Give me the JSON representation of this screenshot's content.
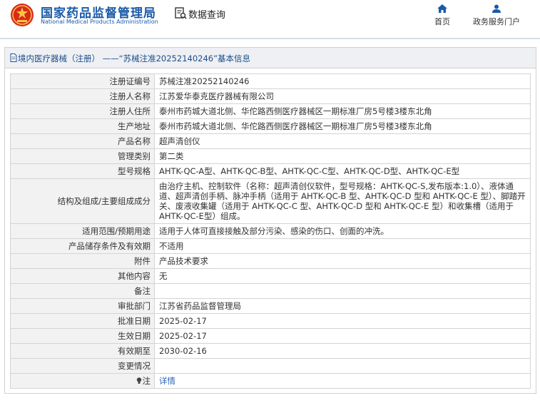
{
  "header": {
    "site_name_cn": "国家药品监督管理局",
    "site_name_en": "National Medical Products Administration",
    "data_query": "数据查询",
    "nav": {
      "home": "首页",
      "service": "政务服务门户"
    }
  },
  "panel": {
    "title": "境内医疗器械（注册） ——“苏械注准20252140246”基本信息"
  },
  "fields": [
    {
      "label": "注册证编号",
      "value": "苏械注准20252140246"
    },
    {
      "label": "注册人名称",
      "value": "江苏爱华泰克医疗器械有限公司"
    },
    {
      "label": "注册人住所",
      "value": "泰州市药城大道北侧、华佗路西侧医疗器械区一期标准厂房5号楼3楼东北角"
    },
    {
      "label": "生产地址",
      "value": "泰州市药城大道北侧、华佗路西侧医疗器械区一期标准厂房5号楼3楼东北角"
    },
    {
      "label": "产品名称",
      "value": "超声清创仪"
    },
    {
      "label": "管理类别",
      "value": "第二类"
    },
    {
      "label": "型号规格",
      "value": "AHTK-QC-A型、AHTK-QC-B型、AHTK-QC-C型、AHTK-QC-D型、AHTK-QC-E型"
    },
    {
      "label": "结构及组成/主要组成成分",
      "value": "由治疗主机、控制软件（名称：超声清创仪软件，型号规格：AHTK-QC-S,发布版本:1.0）、液体通道、超声清创手柄、脉冲手柄（适用于 AHTK-QC-B 型、AHTK-QC-D 型和 AHTK-QC-E 型）、脚踏开关、废液收集罐（适用于 AHTK-QC-C 型、AHTK-QC-D 型和 AHTK-QC-E 型）和收集槽（适用于 AHTK-QC-E型）组成。"
    },
    {
      "label": "适用范围/预期用途",
      "value": "适用于人体可直接接触及部分污染、感染的伤口、创面的冲洗。"
    },
    {
      "label": "产品储存条件及有效期",
      "value": "不适用"
    },
    {
      "label": "附件",
      "value": "产品技术要求"
    },
    {
      "label": "其他内容",
      "value": "无"
    },
    {
      "label": "备注",
      "value": ""
    },
    {
      "label": "审批部门",
      "value": "江苏省药品监督管理局"
    },
    {
      "label": "批准日期",
      "value": "2025-02-17"
    },
    {
      "label": "生效日期",
      "value": "2025-02-17"
    },
    {
      "label": "有效期至",
      "value": "2030-02-16"
    },
    {
      "label": "变更情况",
      "value": ""
    },
    {
      "label": "注",
      "value": "详情"
    }
  ],
  "icons": {
    "logo": "nmpa-emblem-icon",
    "data_query": "search-document-icon",
    "home": "home-icon",
    "service": "user-icon",
    "panel": "document-icon",
    "note": "lightbulb-icon"
  },
  "colors": {
    "brand": "#1a5aa8",
    "link": "#2a62b6",
    "label_bg": "#f2f2f2"
  }
}
